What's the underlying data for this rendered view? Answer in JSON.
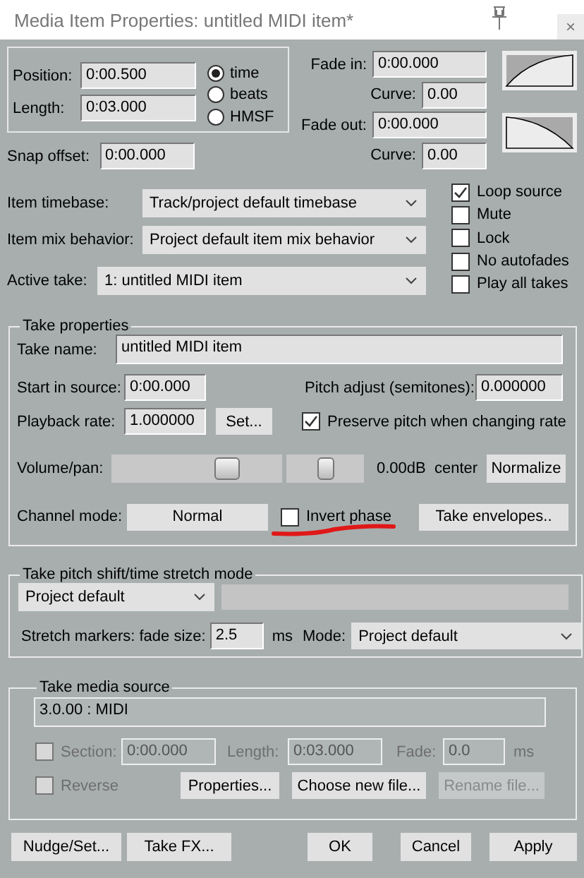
{
  "window": {
    "title": "Media Item Properties:  untitled MIDI item*",
    "close": "×"
  },
  "timing": {
    "fields": [
      {
        "label": "Position:",
        "value": "0:00.500"
      },
      {
        "label": "Length:",
        "value": "0:03.000"
      }
    ],
    "units": [
      {
        "label": "time",
        "selected": true
      },
      {
        "label": "beats",
        "selected": false
      },
      {
        "label": "HMSF",
        "selected": false
      }
    ]
  },
  "fades": [
    {
      "kind": "fade_in",
      "label": "Fade in:",
      "value": "0:00.000",
      "curve_label": "Curve:",
      "curve": "0.00"
    },
    {
      "kind": "fade_out",
      "label": "Fade out:",
      "value": "0:00.000",
      "curve_label": "Curve:",
      "curve": "0.00"
    }
  ],
  "snap_offset": {
    "label": "Snap offset:",
    "value": "0:00.000"
  },
  "dropdowns": [
    {
      "label": "Item timebase:",
      "value": "Track/project default timebase"
    },
    {
      "label": "Item mix behavior:",
      "value": "Project default item mix behavior"
    },
    {
      "label": "Active take:",
      "value": "1: untitled MIDI item"
    }
  ],
  "options": [
    {
      "label": "Loop source",
      "checked": true
    },
    {
      "label": "Mute",
      "checked": false
    },
    {
      "label": "Lock",
      "checked": false
    },
    {
      "label": "No autofades",
      "checked": false
    },
    {
      "label": "Play all takes",
      "checked": false
    }
  ],
  "take": {
    "title": "Take properties",
    "name_label": "Take name:",
    "name": "untitled MIDI item",
    "start_label": "Start in source:",
    "start": "0:00.000",
    "pitch_label": "Pitch adjust (semitones):",
    "pitch": "0.000000",
    "rate_label": "Playback rate:",
    "rate": "1.000000",
    "set_button": "Set...",
    "preserve": {
      "label": "Preserve pitch when changing rate",
      "checked": true
    },
    "volpan_label": "Volume/pan:",
    "volume": {
      "level": 0.68
    },
    "pan": {
      "level": 0.5
    },
    "reading": "0.00dB  center",
    "normalize_button": "Normalize",
    "channel_label": "Channel mode:",
    "channel_mode": "Normal",
    "invert": {
      "label": "Invert phase",
      "checked": false
    },
    "envelopes_button": "Take envelopes.."
  },
  "stretch": {
    "title": "Take pitch shift/time stretch mode",
    "mode": "Project default",
    "fade_label": "Stretch markers: fade size:",
    "fade": "2.5",
    "unit": "ms",
    "mode_label": "Mode:",
    "mode_value": "Project default"
  },
  "source": {
    "title": "Take media source",
    "value": "3.0.00 : MIDI",
    "section": {
      "label": "Section:",
      "checked": false,
      "disabled": true,
      "value": "0:00.000",
      "length_label": "Length:",
      "length": "0:03.000",
      "fade_label": "Fade:",
      "fade": "0.0",
      "unit": "ms"
    },
    "reverse": {
      "label": "Reverse",
      "checked": false,
      "disabled": true
    },
    "buttons": [
      {
        "label": "Properties...",
        "disabled": false
      },
      {
        "label": "Choose new file...",
        "disabled": false
      },
      {
        "label": "Rename file...",
        "disabled": true
      }
    ]
  },
  "footer": [
    {
      "label": "Nudge/Set..."
    },
    {
      "label": "Take FX..."
    },
    {
      "label": "OK"
    },
    {
      "label": "Cancel"
    },
    {
      "label": "Apply"
    }
  ]
}
